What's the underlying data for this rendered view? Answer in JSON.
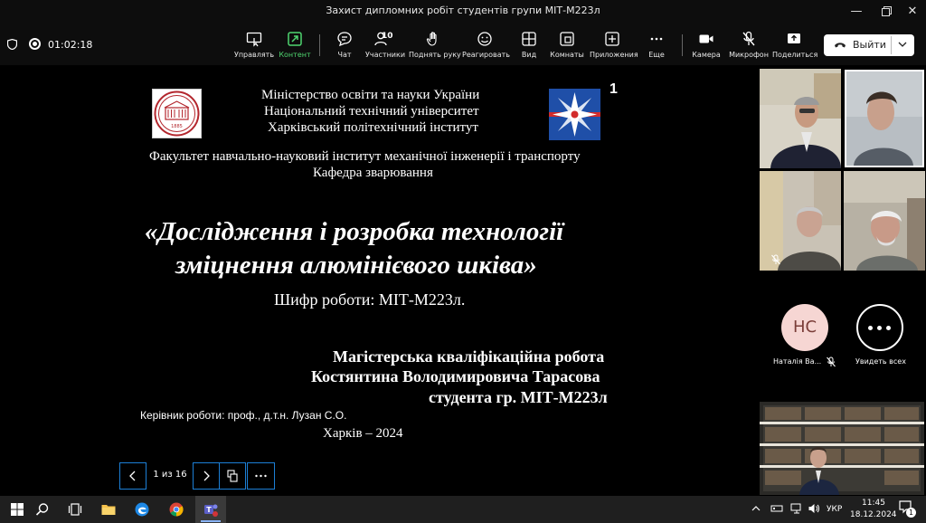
{
  "window": {
    "title": "Захист дипломних робіт студентів групи МІТ-М223л"
  },
  "toolbar": {
    "timer": "01:02:18",
    "participants_count": "10",
    "buttons": [
      {
        "label": "Управлять",
        "icon": "control-icon"
      },
      {
        "label": "Контент",
        "icon": "share-content-icon"
      },
      {
        "label": "Чат",
        "icon": "chat-icon"
      },
      {
        "label": "Участники",
        "icon": "people-icon"
      },
      {
        "label": "Поднять руку",
        "icon": "hand-icon"
      },
      {
        "label": "Реагировать",
        "icon": "smile-icon"
      },
      {
        "label": "Вид",
        "icon": "grid-icon"
      },
      {
        "label": "Комнаты",
        "icon": "rooms-icon"
      },
      {
        "label": "Приложения",
        "icon": "plus-icon"
      },
      {
        "label": "Еще",
        "icon": "more-icon"
      },
      {
        "label": "Камера",
        "icon": "camera-icon"
      },
      {
        "label": "Микрофон",
        "icon": "mic-off-icon"
      },
      {
        "label": "Поделиться",
        "icon": "share-icon"
      }
    ],
    "leave_label": "Выйти"
  },
  "slide": {
    "number": "1",
    "ministry": "Міністерство освіти та науки України",
    "university": "Національний технічний університет",
    "institute": "Харківський політехнічний інститут",
    "faculty": "Факультет навчально-науковий інститут механічної інженерії і транспорту",
    "department": "Кафедра зварювання",
    "title_line1": "«Дослідження і розробка технології",
    "title_line2": "зміцнення алюмінієвого шківа»",
    "code": "Шифр роботи: МІТ-М223л.",
    "work_type": "Магістерська кваліфікаційна робота",
    "author": "Костянтина Володимировича Тарасова",
    "group": "студента гр. МІТ-М223л",
    "supervisor": "Керівник роботи: проф., д.т.н. Лузан С.О.",
    "city_year": "Харків – 2024",
    "logo_text": "1885"
  },
  "slide_nav": {
    "counter": "1 из 16"
  },
  "panel": {
    "avatar_initials": "НС",
    "participant_name": "Наталія Ва...",
    "see_all_label": "Увидеть всех"
  },
  "taskbar": {
    "lang": "УКР",
    "time": "11:45",
    "date": "18.12.2024",
    "notifications": "1"
  }
}
